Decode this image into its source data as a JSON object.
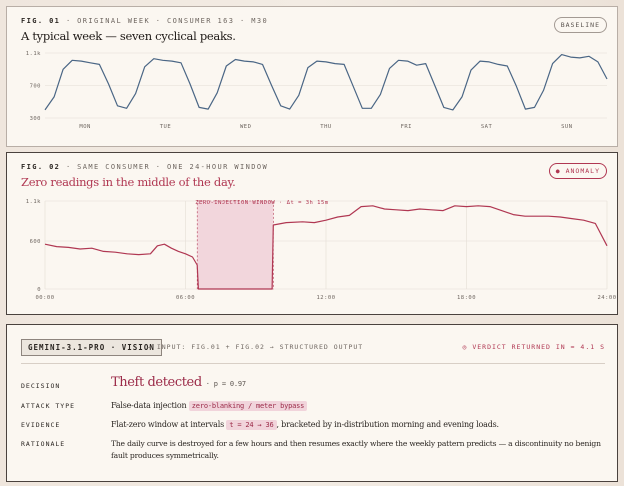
{
  "fig1": {
    "num": "FIG. 01",
    "caption": "· ORIGINAL WEEK · CONSUMER 163 · M30",
    "title": "A typical week — seven cyclical peaks.",
    "badge": "BASELINE"
  },
  "fig2": {
    "num": "FIG. 02",
    "caption": "· SAME CONSUMER · ONE 24-HOUR WINDOW",
    "title": "Zero readings in the middle of the day.",
    "badge": "● ANOMALY",
    "window_label": "ZERO-INJECTION WINDOW · Δt = 3h 15m"
  },
  "analysis": {
    "model": "GEMINI-3.1-PRO · VISION",
    "pipeline": "→ INPUT: FIG.01 + FIG.02 → STRUCTURED OUTPUT",
    "verdict_note": "◎ VERDICT RETURNED IN ≈ 4.1 S",
    "rows": {
      "decision": {
        "label": "DECISION",
        "value": "Theft detected",
        "p": "· p = 0.97"
      },
      "attack": {
        "label": "ATTACK TYPE",
        "value": "False-data injection",
        "chip": "zero-blanking / meter bypass"
      },
      "evidence": {
        "label": "EVIDENCE",
        "pre": "Flat-zero window at intervals",
        "chip": "t = 24 → 36",
        "post": ", bracketed by in-distribution morning and evening loads."
      },
      "rationale": {
        "label": "RATIONALE",
        "line1": "The daily curve is destroyed for a few hours and then resumes exactly where the weekly pattern predicts — a discontinuity no benign",
        "line2": "fault produces symmetrically."
      }
    }
  },
  "colors": {
    "week_line": "#4a6685",
    "day_line": "#b03752",
    "window_fill": "#f2d6dc",
    "grid": "#e4ddd5"
  },
  "chart_data": [
    {
      "type": "line",
      "title": "A typical week — seven cyclical peaks.",
      "categories": [
        "MON",
        "TUE",
        "WED",
        "THU",
        "FRI",
        "SAT",
        "SUN"
      ],
      "yticks": [
        "1.1k",
        "700",
        "300"
      ],
      "ylim": [
        300,
        1100
      ],
      "grid": true,
      "series": [
        {
          "values": [
            400,
            560,
            900,
            1010,
            1000,
            980,
            960,
            720,
            450,
            420,
            600,
            930,
            1030,
            1010,
            1000,
            980,
            720,
            430,
            410,
            610,
            940,
            1020,
            1000,
            990,
            960,
            700,
            450,
            410,
            580,
            920,
            1000,
            990,
            970,
            960,
            690,
            420,
            420,
            590,
            910,
            1010,
            1000,
            950,
            970,
            700,
            430,
            400,
            560,
            890,
            1000,
            990,
            960,
            940,
            690,
            410,
            430,
            640,
            970,
            1080,
            1050,
            1040,
            1060,
            990,
            780
          ]
        }
      ]
    },
    {
      "type": "line",
      "title": "Zero readings in the middle of the day.",
      "x_ticks": [
        "00:00",
        "06:00",
        "12:00",
        "18:00",
        "24:00"
      ],
      "yticks": [
        "1.1k",
        "600",
        "0"
      ],
      "ylim": [
        0,
        1100
      ],
      "grid": true,
      "window_hours": [
        6.5,
        9.75
      ],
      "series": [
        {
          "x": [
            0,
            0.5,
            1,
            1.5,
            2,
            2.5,
            3,
            3.5,
            4,
            4.5,
            4.8,
            5.1,
            5.4,
            5.7,
            6.0,
            6.3,
            6.5,
            6.55,
            9.7,
            9.75,
            10.3,
            11,
            11.5,
            12,
            12.5,
            13,
            13.5,
            14,
            14.5,
            15,
            15.5,
            16,
            16.5,
            17,
            17.5,
            18,
            18.5,
            19,
            19.5,
            20,
            20.5,
            21,
            21.5,
            22,
            22.5,
            23,
            23.5,
            24
          ],
          "values": [
            560,
            530,
            520,
            500,
            510,
            470,
            460,
            440,
            430,
            440,
            540,
            560,
            510,
            470,
            440,
            400,
            300,
            0,
            0,
            800,
            830,
            840,
            830,
            860,
            900,
            920,
            1030,
            1040,
            1000,
            990,
            980,
            1000,
            990,
            980,
            1040,
            1030,
            1040,
            1030,
            980,
            930,
            910,
            910,
            910,
            900,
            880,
            860,
            820,
            540
          ]
        }
      ]
    }
  ]
}
